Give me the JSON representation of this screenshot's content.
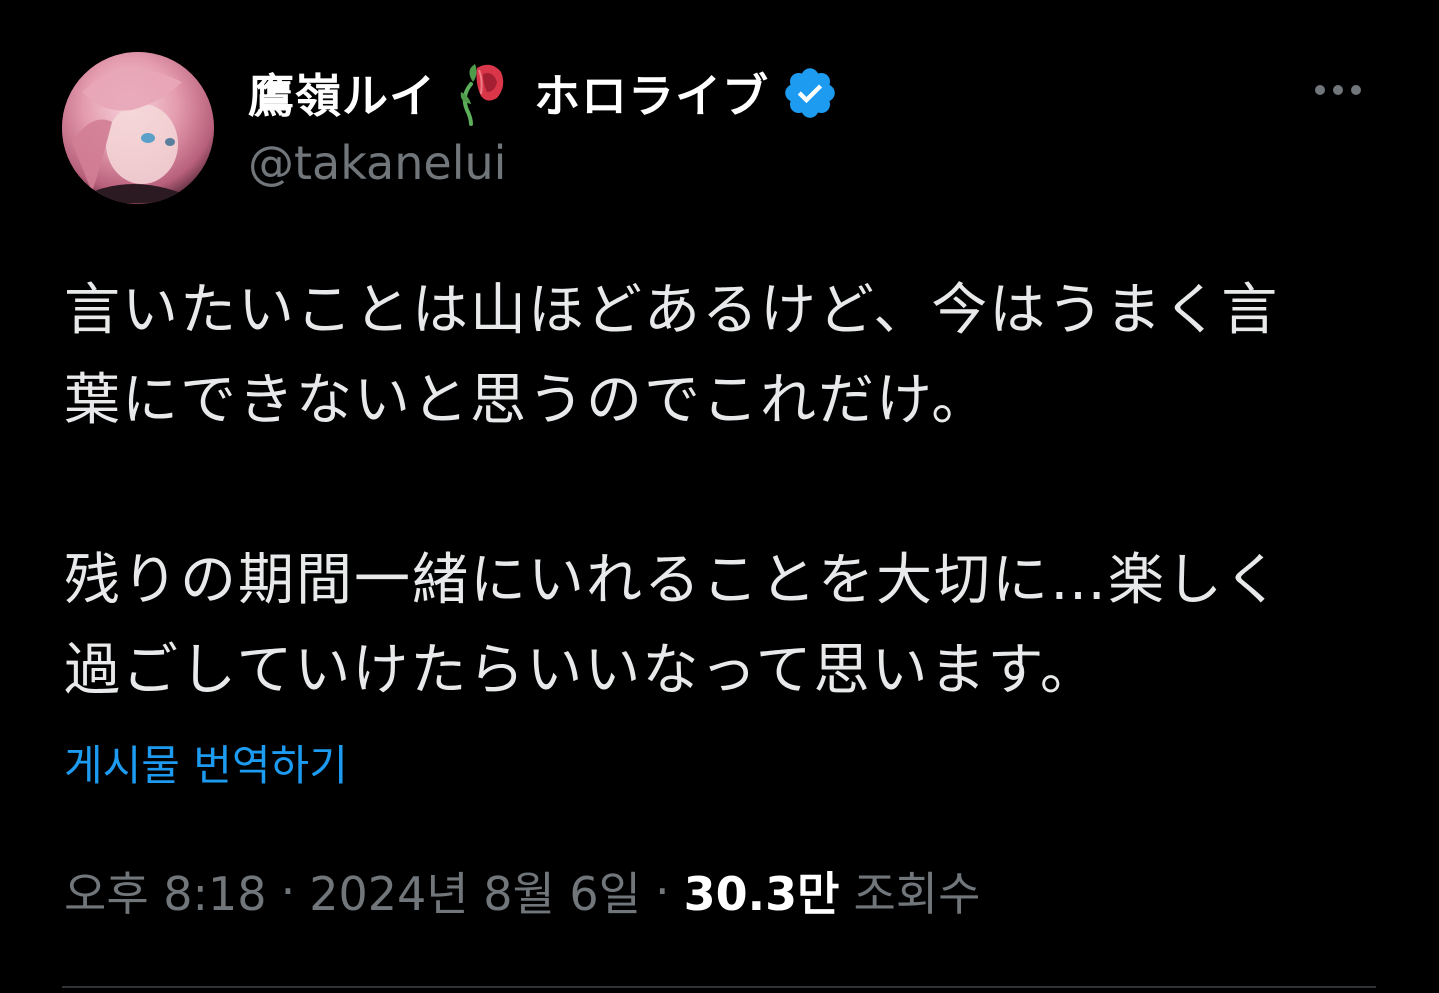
{
  "author": {
    "name_part1": "鷹嶺ルイ",
    "name_part2": "ホロライブ",
    "handle": "@takanelui",
    "verified": true,
    "rose_icon": "wilted-rose-icon",
    "verified_icon": "verified-badge-icon"
  },
  "post": {
    "paragraph1": "言いたいことは山ほどあるけど、今はうまく言\n葉にできないと思うのでこれだけ。",
    "paragraph2": "残りの期間一緒にいれることを大切に…楽しく\n過ごしていけたらいいなって思います。"
  },
  "translate_label": "게시물 번역하기",
  "meta": {
    "time": "오후 8:18",
    "separator": "·",
    "date": "2024년 8월 6일",
    "views_count": "30.3만",
    "views_label": "조회수"
  },
  "colors": {
    "background": "#000000",
    "text": "#e7e9ea",
    "muted": "#71767b",
    "link": "#1d9bf0",
    "verified": "#1d9bf0"
  }
}
